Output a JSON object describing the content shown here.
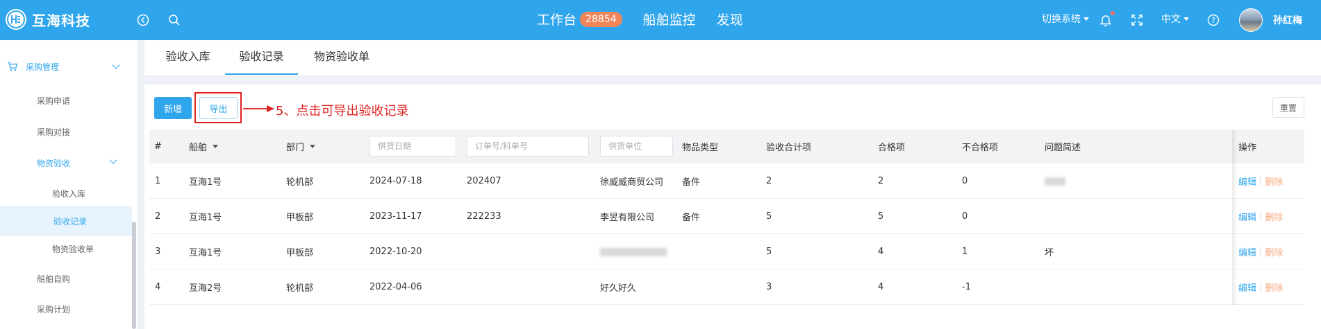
{
  "header": {
    "brand": "互海科技",
    "nav": {
      "workbench": "工作台",
      "workbench_badge": "28854",
      "ship_monitor": "船舶监控",
      "discover": "发现"
    },
    "switch_system": "切换系统",
    "language": "中文",
    "username": "孙红梅",
    "icons": [
      "back-circle-icon",
      "search-icon",
      "bell-icon",
      "fullscreen-icon",
      "help-icon"
    ],
    "color": "#2fa5ec"
  },
  "sidebar": {
    "items": [
      {
        "label": "采购管理",
        "level": 1
      },
      {
        "label": "采购申请",
        "level": 2
      },
      {
        "label": "采购对接",
        "level": 2
      },
      {
        "label": "物资验收",
        "level": 2
      },
      {
        "label": "验收入库",
        "level": 3
      },
      {
        "label": "验收记录",
        "level": 3,
        "active": true
      },
      {
        "label": "物资验收单",
        "level": 3
      },
      {
        "label": "船舶自购",
        "level": 2
      },
      {
        "label": "采购计划",
        "level": 2
      }
    ]
  },
  "tabs": [
    "验收入库",
    "验收记录",
    "物资验收单"
  ],
  "toolbar": {
    "add_label": "新增",
    "export_label": "导出",
    "reset_label": "重置",
    "annotation": "5、点击可导出验收记录",
    "annotation_color": "#e02020"
  },
  "table": {
    "columns": {
      "index": "#",
      "ship": "船舶",
      "dept": "部门",
      "supply_date_placeholder": "供货日期",
      "order_placeholder": "订单号/料单号",
      "supplier_placeholder": "供货单位",
      "category": "物品类型",
      "total": "验收合计项",
      "qualified": "合格项",
      "unqualified": "不合格项",
      "issue": "问题简述",
      "actions": "操作"
    },
    "rows": [
      {
        "index": "1",
        "ship": "互海1号",
        "dept": "轮机部",
        "date": "2024-07-18",
        "order": "202407",
        "supplier": "徐威威商贸公司",
        "category": "备件",
        "total": "2",
        "qualified": "2",
        "unqualified": "0",
        "issue": ""
      },
      {
        "index": "2",
        "ship": "互海1号",
        "dept": "甲板部",
        "date": "2023-11-17",
        "order": "222233",
        "supplier": "李昱有限公司",
        "category": "备件",
        "total": "5",
        "qualified": "5",
        "unqualified": "0",
        "issue": ""
      },
      {
        "index": "3",
        "ship": "互海1号",
        "dept": "甲板部",
        "date": "2022-10-20",
        "order": "",
        "supplier": "",
        "category": "",
        "total": "5",
        "qualified": "4",
        "unqualified": "1",
        "issue": "坏"
      },
      {
        "index": "4",
        "ship": "互海2号",
        "dept": "轮机部",
        "date": "2022-04-06",
        "order": "",
        "supplier": "好久好久",
        "category": "",
        "total": "3",
        "qualified": "4",
        "unqualified": "-1",
        "issue": ""
      }
    ],
    "edit_label": "编辑",
    "delete_label": "删除",
    "separator": "|"
  }
}
